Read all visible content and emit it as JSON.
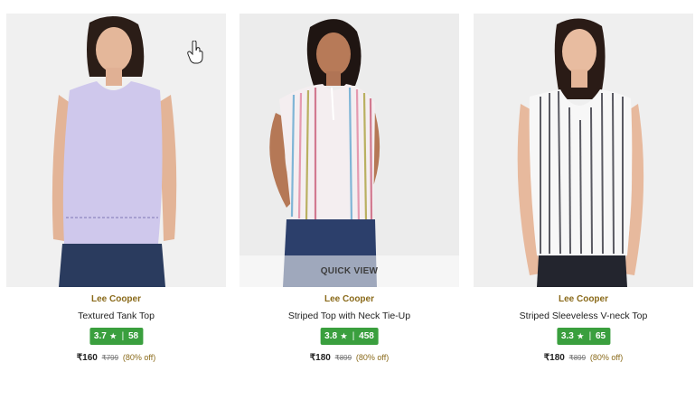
{
  "products": [
    {
      "brand": "Lee Cooper",
      "name": "Textured Tank Top",
      "rating": "3.7",
      "rating_count": "58",
      "price": "₹160",
      "mrp": "₹799",
      "discount": "(80% off)",
      "colors": {
        "top": "#cfc8ec",
        "bg": "#efefef",
        "pants": "#2a3b5e"
      }
    },
    {
      "brand": "Lee Cooper",
      "name": "Striped Top with Neck Tie-Up",
      "rating": "3.8",
      "rating_count": "458",
      "price": "₹180",
      "mrp": "₹899",
      "discount": "(80% off)",
      "quick_view": "QUICK VIEW",
      "colors": {
        "top": "#f4eef0",
        "bg": "#ececec",
        "pants": "#2c3f6b"
      }
    },
    {
      "brand": "Lee Cooper",
      "name": "Striped Sleeveless V-neck Top",
      "rating": "3.3",
      "rating_count": "65",
      "price": "₹180",
      "mrp": "₹899",
      "discount": "(80% off)",
      "colors": {
        "top": "#f7f7f7",
        "bg": "#efefef",
        "pants": "#23252e"
      }
    }
  ],
  "icons": {
    "star": "star-icon",
    "cursor": "hand-pointer-cursor-icon"
  },
  "accent_colors": {
    "rating_badge": "#3a9f3e",
    "brand_text": "#8a6a1a"
  }
}
